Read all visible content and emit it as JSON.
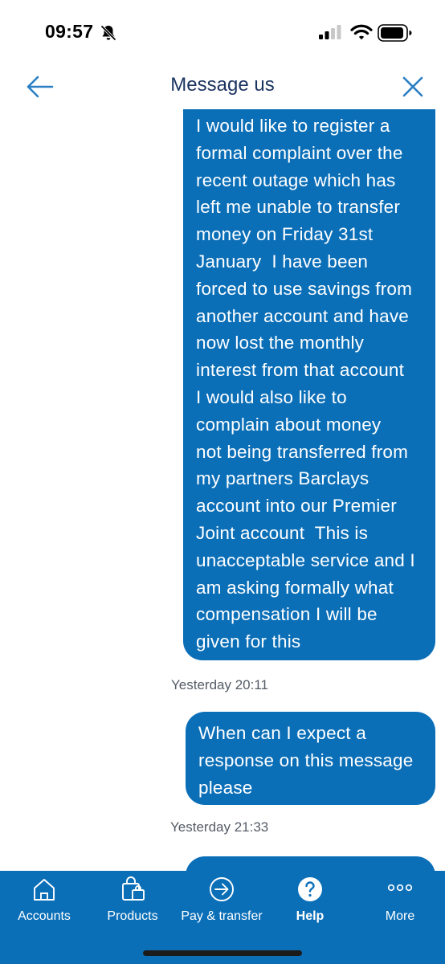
{
  "status_bar": {
    "time": "09:57"
  },
  "header": {
    "title": "Message us"
  },
  "chat": {
    "messages": [
      {
        "text": "I would like to register a\nformal complaint over the\nrecent outage which has\nleft me unable to transfer\nmoney on Friday 31st\nJanuary  I have been\nforced to use savings from\nanother account and have\nnow lost the monthly\ninterest from that account\nI would also like to\ncomplain about money\nnot being transferred from\nmy partners Barclays\naccount into our Premier\nJoint account  This is\nunacceptable service and I\nam asking formally what\ncompensation I will be\ngiven for this",
        "timestamp": "Yesterday 20:11"
      },
      {
        "text": "When can I expect a\nresponse on this message\nplease",
        "timestamp": "Yesterday 21:33"
      }
    ]
  },
  "bottom_nav": {
    "items": [
      {
        "label": "Accounts",
        "icon": "home-icon"
      },
      {
        "label": "Products",
        "icon": "shopping-bag-icon"
      },
      {
        "label": "Pay & transfer",
        "icon": "arrow-circle-icon"
      },
      {
        "label": "Help",
        "icon": "question-circle-icon",
        "active": true
      },
      {
        "label": "More",
        "icon": "more-dots-icon"
      }
    ]
  },
  "colors": {
    "brand_blue": "#0b6fb8",
    "title_navy": "#1c3461",
    "icon_blue": "#2b7fc4"
  }
}
